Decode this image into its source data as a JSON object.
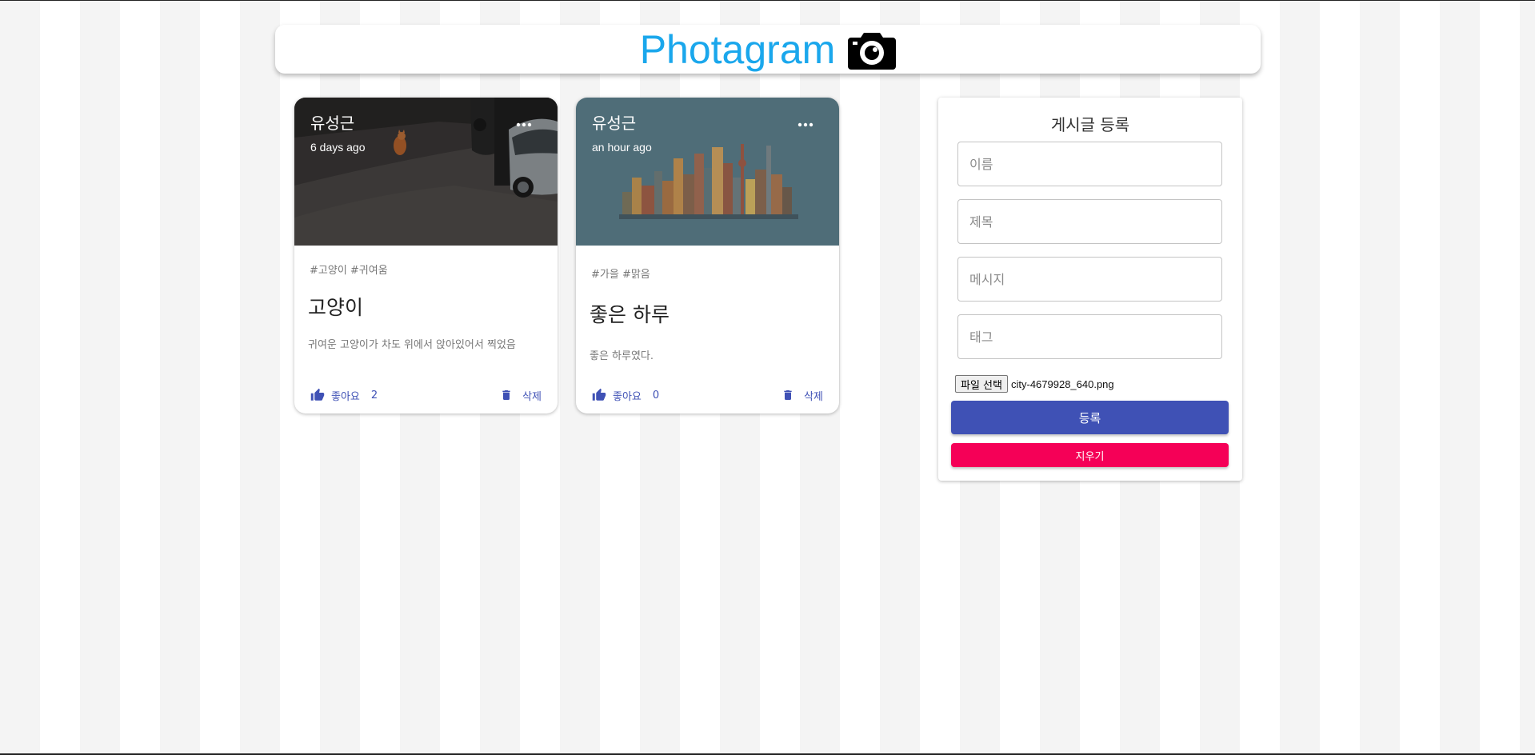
{
  "header": {
    "title": "Photagram",
    "icon": "camera-icon"
  },
  "posts": [
    {
      "author": "유성근",
      "time": "6 days ago",
      "tags": "#고양이 #귀여움",
      "title": "고양이",
      "message": "귀여운 고양이가 차도 위에서 앉아있어서 찍었음",
      "like_label": "좋아요",
      "like_count": "2",
      "delete_label": "삭제"
    },
    {
      "author": "유성근",
      "time": "an hour ago",
      "tags": "#가을 #맑음",
      "title": "좋은 하루",
      "message": "좋은 하루였다.",
      "like_label": "좋아요",
      "like_count": "0",
      "delete_label": "삭제"
    }
  ],
  "form": {
    "title": "게시글 등록",
    "name_placeholder": "이름",
    "title_placeholder": "제목",
    "message_placeholder": "메시지",
    "tags_placeholder": "태그",
    "file_button": "파일 선택",
    "file_name": "city-4679928_640.png",
    "submit_label": "등록",
    "clear_label": "지우기"
  },
  "colors": {
    "brand": "#1aa7ec",
    "primary": "#3f51b5",
    "secondary": "#f50057"
  }
}
